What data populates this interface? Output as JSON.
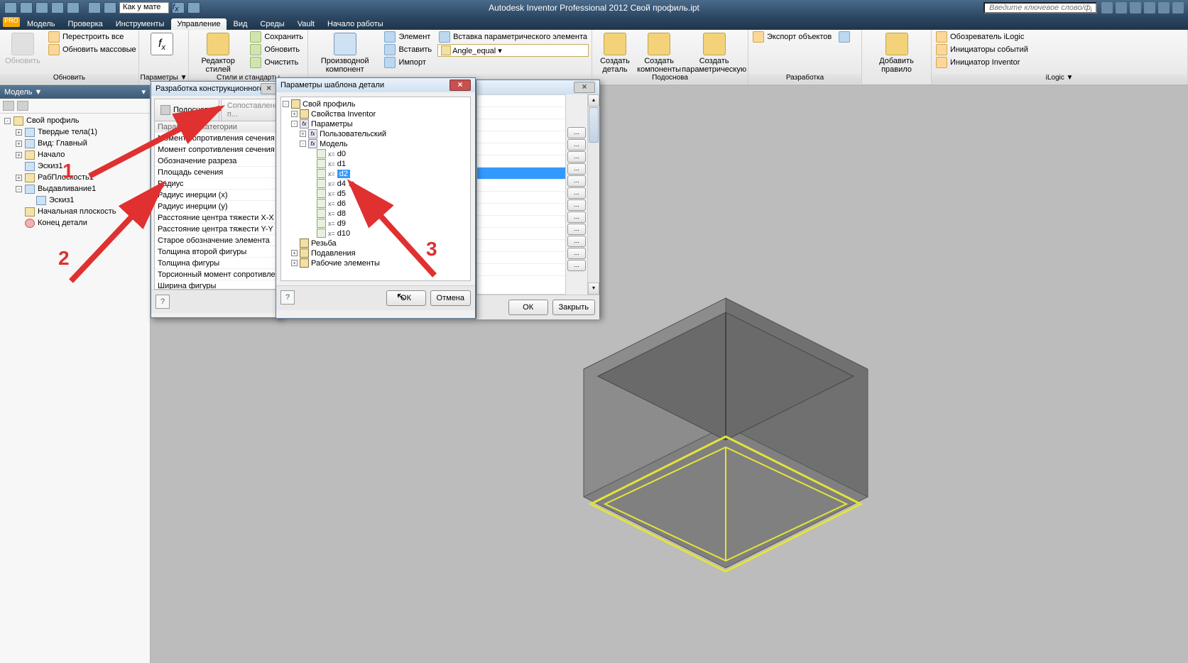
{
  "title": "Autodesk Inventor Professional 2012   Свой профиль.ipt",
  "search_placeholder": "Введите ключевое слово/фразу",
  "material": "Как у мате",
  "tabs": [
    "Модель",
    "Проверка",
    "Инструменты",
    "Управление",
    "Вид",
    "Среды",
    "Vault",
    "Начало работы"
  ],
  "tabs_active": 3,
  "ribbon": {
    "groups": {
      "g1": "Обновить",
      "g2": "Параметры ▼",
      "g3": "Стили и стандарты",
      "g5": "Подоснова",
      "g6": "Разработка",
      "g7": "iLogic ▼"
    },
    "btn_update": "Обновить",
    "items_col1": [
      "Перестроить все",
      "Обновить массовые"
    ],
    "fx_btn": "",
    "params_big": "Параметры",
    "styleed": "Редактор стилей",
    "items_col_style": [
      "Сохранить",
      "Обновить",
      "Очистить"
    ],
    "deriv_big": "Производной компонент",
    "items_col_insert": [
      "Элемент",
      "Вставить",
      "Импорт"
    ],
    "items_insert2": [
      "Вставка параметрического элемента"
    ],
    "angle_label": "Angle_equal ▾",
    "create_part": "Создать деталь",
    "create_comp": "Создать компоненты",
    "create_param": "Создать параметрическую деталь",
    "export_obj": "Экспорт объектов",
    "add_rule": "Добавить правило",
    "ilogic_items": [
      "Обозреватель iLogic",
      "Инициаторы событий",
      "Инициатор Inventor"
    ]
  },
  "browser": {
    "header": "Модель ▼",
    "nodes": [
      {
        "lvl": 0,
        "exp": "-",
        "t": "Свой профиль",
        "icon": "doc"
      },
      {
        "lvl": 1,
        "exp": "+",
        "t": "Твердые тела(1)",
        "icon": "blue"
      },
      {
        "lvl": 1,
        "exp": "+",
        "t": "Вид: Главный",
        "icon": "blue"
      },
      {
        "lvl": 1,
        "exp": "+",
        "t": "Начало",
        "icon": "doc"
      },
      {
        "lvl": 1,
        "exp": " ",
        "t": "Эскиз1",
        "icon": "blue"
      },
      {
        "lvl": 1,
        "exp": "+",
        "t": "РабПлоскость1",
        "icon": "doc"
      },
      {
        "lvl": 1,
        "exp": "-",
        "t": "Выдавливание1",
        "icon": "blue"
      },
      {
        "lvl": 2,
        "exp": " ",
        "t": "Эскиз1",
        "icon": "blue"
      },
      {
        "lvl": 1,
        "exp": " ",
        "t": "Начальная плоскость",
        "icon": "doc"
      },
      {
        "lvl": 1,
        "exp": " ",
        "t": "Конец детали",
        "icon": "red"
      }
    ]
  },
  "dlg1": {
    "title": "Разработка конструкционного профиля",
    "tab1": "Подоснова",
    "tab2": "Сопоставление п...",
    "listheader": "Параметры категории",
    "rows": [
      "Момент сопротивления сечения (x)",
      "Момент сопротивления сечения (y)",
      "Обозначение разреза",
      "Площадь сечения",
      "Радиус",
      "Радиус инерции (x)",
      "Радиус инерции (y)",
      "Расстояние центра тяжести X-X",
      "Расстояние центра тяжести Y-Y",
      "Старое обозначение элемента",
      "Толщина второй фигуры",
      "Толщина фигуры",
      "Торсионный момент сопротивления",
      "Ширина фигуры"
    ]
  },
  "dlg2": {
    "title": "Параметры шаблона детали",
    "ok": "ОК",
    "cancel": "Отмена",
    "tree": [
      {
        "l": 0,
        "exp": "-",
        "ic": "doc",
        "t": "Свой профиль"
      },
      {
        "l": 1,
        "exp": "+",
        "ic": "doc",
        "t": "Свойства Inventor"
      },
      {
        "l": 1,
        "exp": "-",
        "ic": "fx",
        "t": "Параметры"
      },
      {
        "l": 2,
        "exp": "+",
        "ic": "fx",
        "t": "Пользовательский"
      },
      {
        "l": 2,
        "exp": "-",
        "ic": "fx",
        "t": "Модель"
      },
      {
        "l": 3,
        "exp": " ",
        "ic": "xl",
        "t": "d0"
      },
      {
        "l": 3,
        "exp": " ",
        "ic": "xl",
        "t": "d1"
      },
      {
        "l": 3,
        "exp": " ",
        "ic": "xl",
        "t": "d2",
        "sel": true
      },
      {
        "l": 3,
        "exp": " ",
        "ic": "xl",
        "t": "d4"
      },
      {
        "l": 3,
        "exp": " ",
        "ic": "xl",
        "t": "d5"
      },
      {
        "l": 3,
        "exp": " ",
        "ic": "xl",
        "t": "d6"
      },
      {
        "l": 3,
        "exp": " ",
        "ic": "xl",
        "t": "d8"
      },
      {
        "l": 3,
        "exp": " ",
        "ic": "xl",
        "t": "d9"
      },
      {
        "l": 3,
        "exp": " ",
        "ic": "xl",
        "t": "d10"
      },
      {
        "l": 1,
        "exp": " ",
        "ic": "doc",
        "t": "Резьба"
      },
      {
        "l": 1,
        "exp": "+",
        "ic": "doc",
        "t": "Подавления"
      },
      {
        "l": 1,
        "exp": "+",
        "ic": "doc",
        "t": "Рабочие элементы"
      }
    ]
  },
  "dlg3": {
    "ellipsis": "...",
    "ok": "ОК",
    "close": "Закрыть"
  },
  "ann": {
    "n1": "1",
    "n2": "2",
    "n3": "3"
  }
}
